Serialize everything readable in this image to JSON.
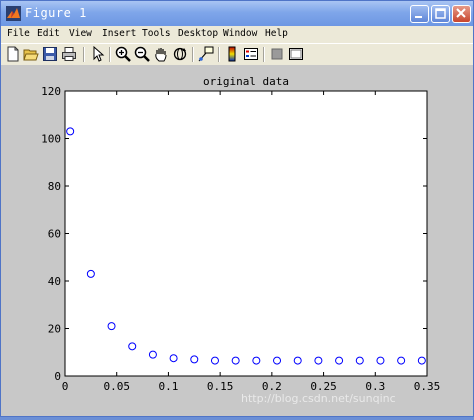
{
  "window": {
    "title": "Figure 1",
    "icon": "matlab-icon",
    "controls": [
      "minimize-icon",
      "maximize-icon",
      "close-icon"
    ]
  },
  "menu": [
    "File",
    "Edit",
    "View",
    "Insert",
    "Tools",
    "Desktop",
    "Window",
    "Help"
  ],
  "toolbar": {
    "icons": [
      "new-figure-icon",
      "open-file-icon",
      "save-icon",
      "print-icon",
      "edit-plot-arrow-icon",
      "zoom-in-icon",
      "zoom-out-icon",
      "pan-hand-icon",
      "rotate-3d-icon",
      "data-cursor-icon",
      "insert-colorbar-icon",
      "insert-legend-icon",
      "hide-plot-tools-icon",
      "show-plot-tools-icon"
    ]
  },
  "watermark": "http://blog.csdn.net/sunqinc",
  "chart_data": {
    "type": "scatter",
    "title": "original data",
    "xlabel": "",
    "ylabel": "",
    "xlim": [
      0,
      0.35
    ],
    "ylim": [
      0,
      120
    ],
    "x_ticks": [
      0,
      0.05,
      0.1,
      0.15,
      0.2,
      0.25,
      0.3,
      0.35
    ],
    "x_tick_labels": [
      "0",
      "0.05",
      "0.1",
      "0.15",
      "0.2",
      "0.25",
      "0.3",
      "0.35"
    ],
    "y_ticks": [
      0,
      20,
      40,
      60,
      80,
      100,
      120
    ],
    "y_tick_labels": [
      "0",
      "20",
      "40",
      "60",
      "80",
      "100",
      "120"
    ],
    "grid": false,
    "marker": "circle",
    "marker_color": "#0000ff",
    "series": [
      {
        "x": [
          0.005,
          0.025,
          0.045,
          0.065,
          0.085,
          0.105,
          0.125,
          0.145,
          0.165,
          0.185,
          0.205,
          0.225,
          0.245,
          0.265,
          0.285,
          0.305,
          0.325,
          0.345
        ],
        "y": [
          103,
          43,
          21,
          12.5,
          9,
          7.5,
          7,
          6.5,
          6.5,
          6.5,
          6.5,
          6.5,
          6.5,
          6.5,
          6.5,
          6.5,
          6.5,
          6.5
        ]
      }
    ]
  }
}
